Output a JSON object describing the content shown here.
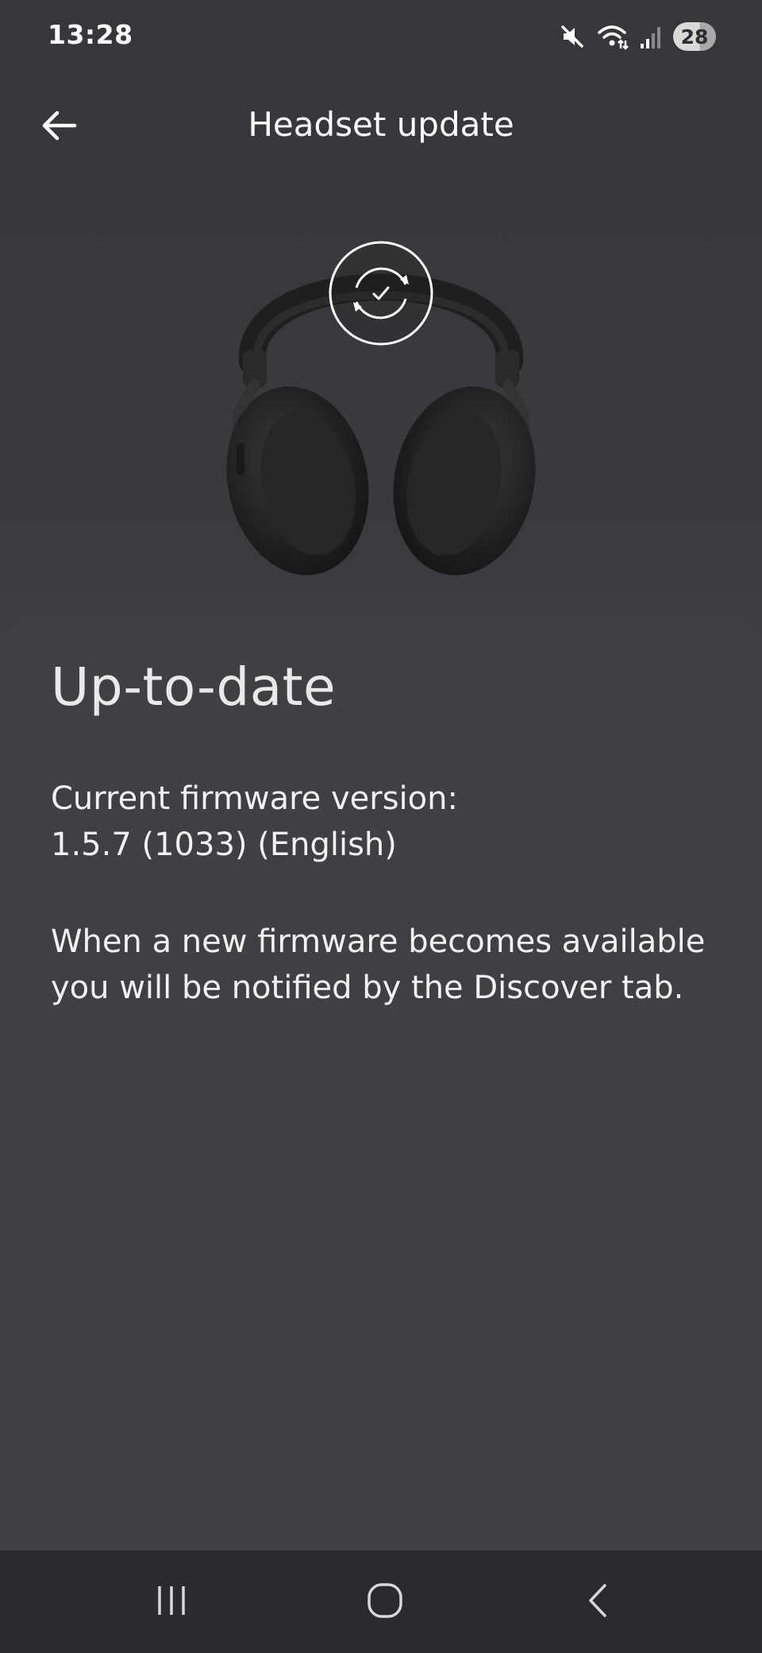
{
  "status_bar": {
    "time": "13:28",
    "battery_level": "28",
    "icons": [
      "mute-icon",
      "wifi-icon",
      "signal-icon",
      "battery-icon"
    ]
  },
  "header": {
    "title": "Headset update",
    "back_icon": "arrow-left-icon"
  },
  "hero": {
    "image": "headset-image",
    "overlay_icon": "sync-check-icon"
  },
  "content": {
    "status_heading": "Up-to-date",
    "firmware_label": "Current firmware version:",
    "firmware_value": "1.5.7 (1033) (English)",
    "notice": "When a new firmware becomes available you will be notified by the Discover tab."
  },
  "nav_bar": {
    "buttons": [
      "recents-icon",
      "home-icon",
      "back-icon"
    ]
  },
  "colors": {
    "background": "#37383c",
    "card": "#3f4044",
    "nav_bar": "#2a2b2e",
    "text": "#ffffff"
  }
}
